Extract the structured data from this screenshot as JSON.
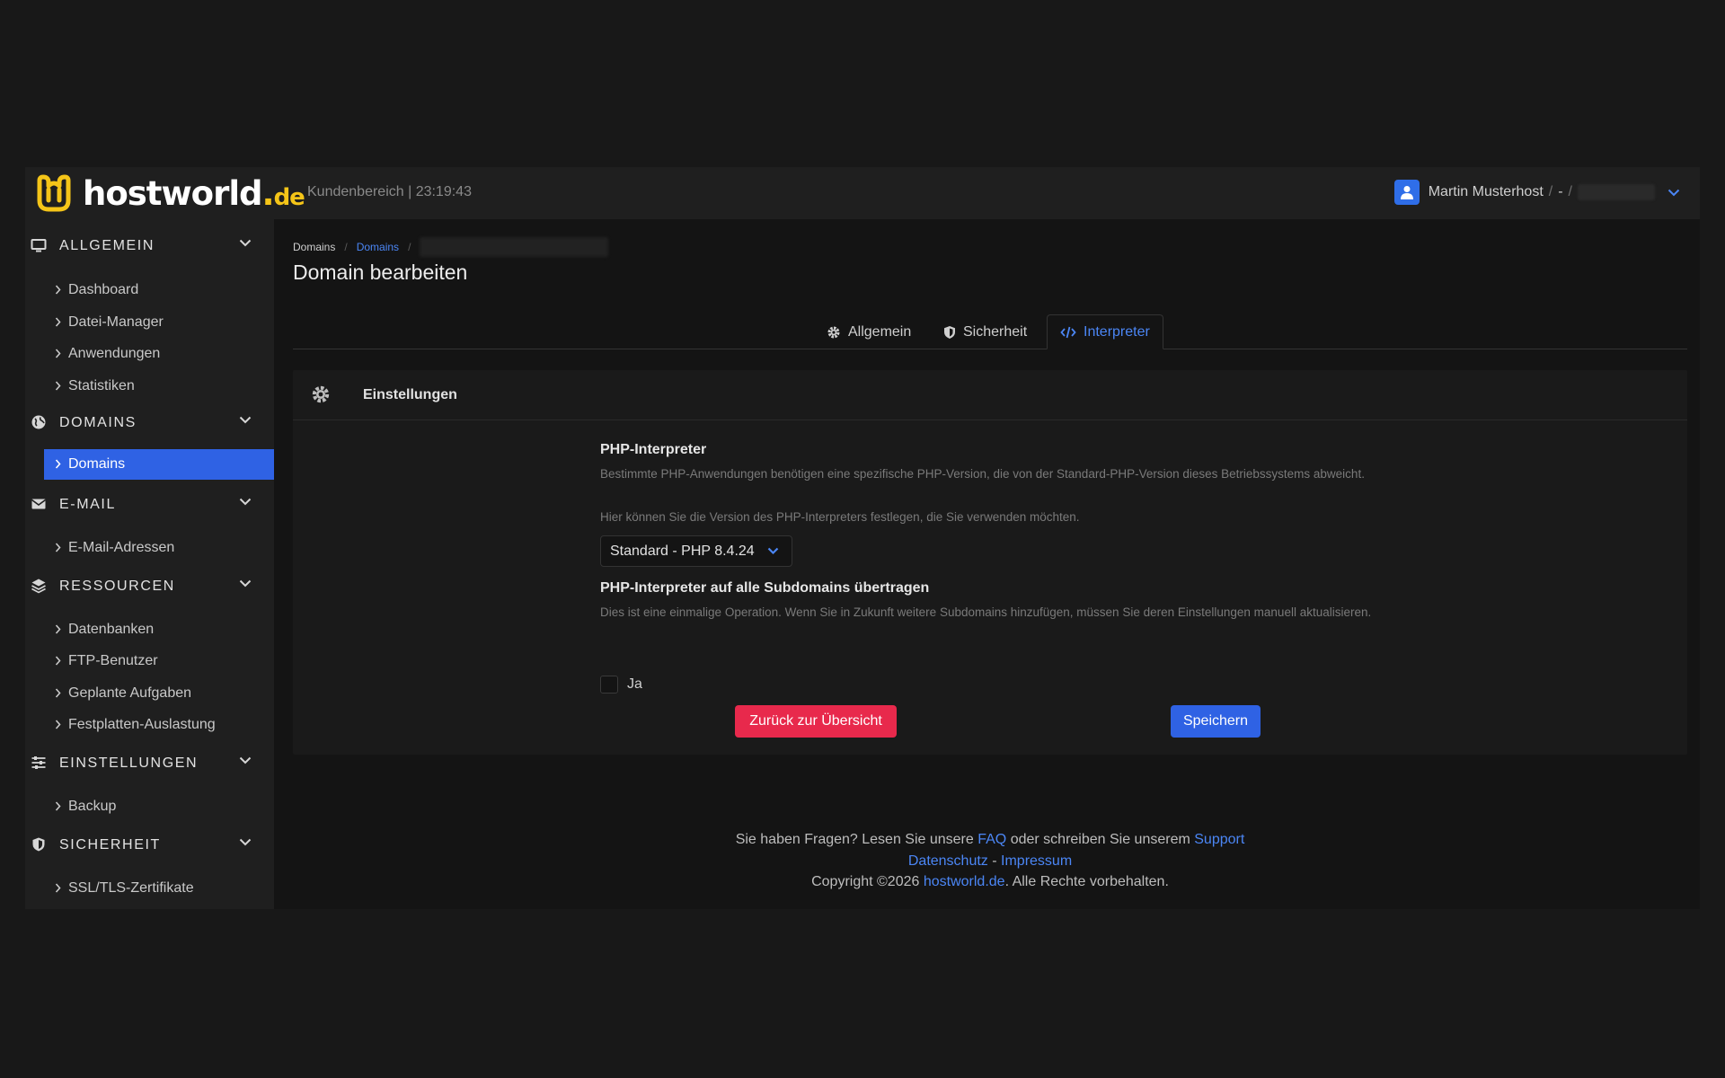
{
  "brand": {
    "name": "hostworld",
    "tld": "de",
    "dot": ".",
    "logo_color": "#f5c518"
  },
  "header": {
    "subtitle": "Kundenbereich | 23:19:43",
    "user_name": "Martin Musterhost",
    "user_sep": "/",
    "user_dash": "-",
    "user_sep2": "/"
  },
  "sidebar": {
    "sections": [
      {
        "label": "ALLGEMEIN",
        "icon": "monitor-icon",
        "items": [
          "Dashboard",
          "Datei-Manager",
          "Anwendungen",
          "Statistiken"
        ]
      },
      {
        "label": "DOMAINS",
        "icon": "globe-icon",
        "items": [
          "Domains"
        ]
      },
      {
        "label": "E-MAIL",
        "icon": "envelope-icon",
        "items": [
          "E-Mail-Adressen"
        ]
      },
      {
        "label": "RESSOURCEN",
        "icon": "layers-icon",
        "items": [
          "Datenbanken",
          "FTP-Benutzer",
          "Geplante Aufgaben",
          "Festplatten-Auslastung"
        ]
      },
      {
        "label": "EINSTELLUNGEN",
        "icon": "sliders-icon",
        "items": [
          "Backup"
        ]
      },
      {
        "label": "SICHERHEIT",
        "icon": "shield-icon",
        "items": [
          "SSL/TLS-Zertifikate"
        ]
      }
    ],
    "active_item": "Domains"
  },
  "breadcrumb": {
    "root": "Domains",
    "link": "Domains",
    "sep": "/"
  },
  "page_title": "Domain bearbeiten",
  "tabs": [
    {
      "label": "Allgemein",
      "icon": "gear-icon"
    },
    {
      "label": "Sicherheit",
      "icon": "shield-icon"
    },
    {
      "label": "Interpreter",
      "icon": "code-icon",
      "active": true
    }
  ],
  "card": {
    "title": "Einstellungen",
    "php": {
      "label": "PHP-Interpreter",
      "help_1": "Bestimmte PHP-Anwendungen benötigen eine spezifische PHP-Version, die von der Standard-PHP-Version dieses Betriebssystems abweicht.",
      "help_2": "Hier können Sie die Version des PHP-Interpreters festlegen, die Sie verwenden möchten.",
      "selected": "Standard - PHP 8.4.24"
    },
    "subdomains": {
      "label": "PHP-Interpreter auf alle Subdomains übertragen",
      "help": "Dies ist eine einmalige Operation. Wenn Sie in Zukunft weitere Subdomains hinzufügen, müssen Sie deren Einstellungen manuell aktualisieren.",
      "checkbox_label": "Ja",
      "checked": false
    },
    "back_button": "Zurück zur Übersicht",
    "save_button": "Speichern"
  },
  "footer": {
    "line1_a": "Sie haben Fragen? Lesen Sie unsere ",
    "faq": "FAQ",
    "line1_b": " oder schreiben Sie unserem ",
    "support": "Support",
    "privacy": "Datenschutz",
    "dash": " - ",
    "imprint": "Impressum",
    "copyright_a": "Copyright ©2026 ",
    "copyright_link": "hostworld.de",
    "copyright_b": ". Alle Rechte vorbehalten."
  },
  "colors": {
    "accent": "#2f62e4",
    "link": "#4b86f5",
    "danger": "#e8294c",
    "background": "#141414"
  }
}
